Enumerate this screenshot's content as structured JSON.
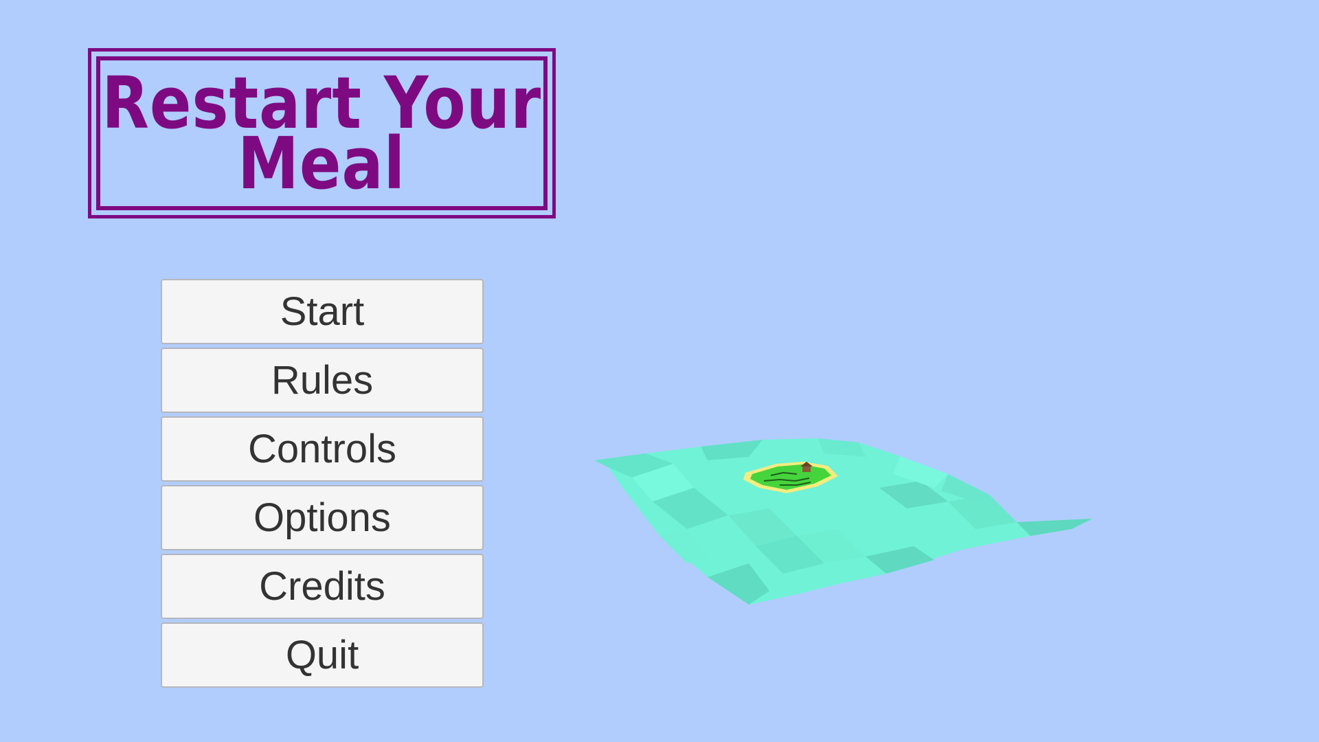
{
  "title": {
    "line1": "Restart Your",
    "line2": "Meal"
  },
  "menu": {
    "start": "Start",
    "rules": "Rules",
    "controls": "Controls",
    "options": "Options",
    "credits": "Credits",
    "quit": "Quit"
  },
  "colors": {
    "background": "#b1cdfd",
    "title": "#7e0a82",
    "button_face": "#f5f5f6",
    "button_text": "#333333",
    "water": "#6ff5d8",
    "grass": "#45d43c",
    "sand": "#f4ec7e"
  }
}
